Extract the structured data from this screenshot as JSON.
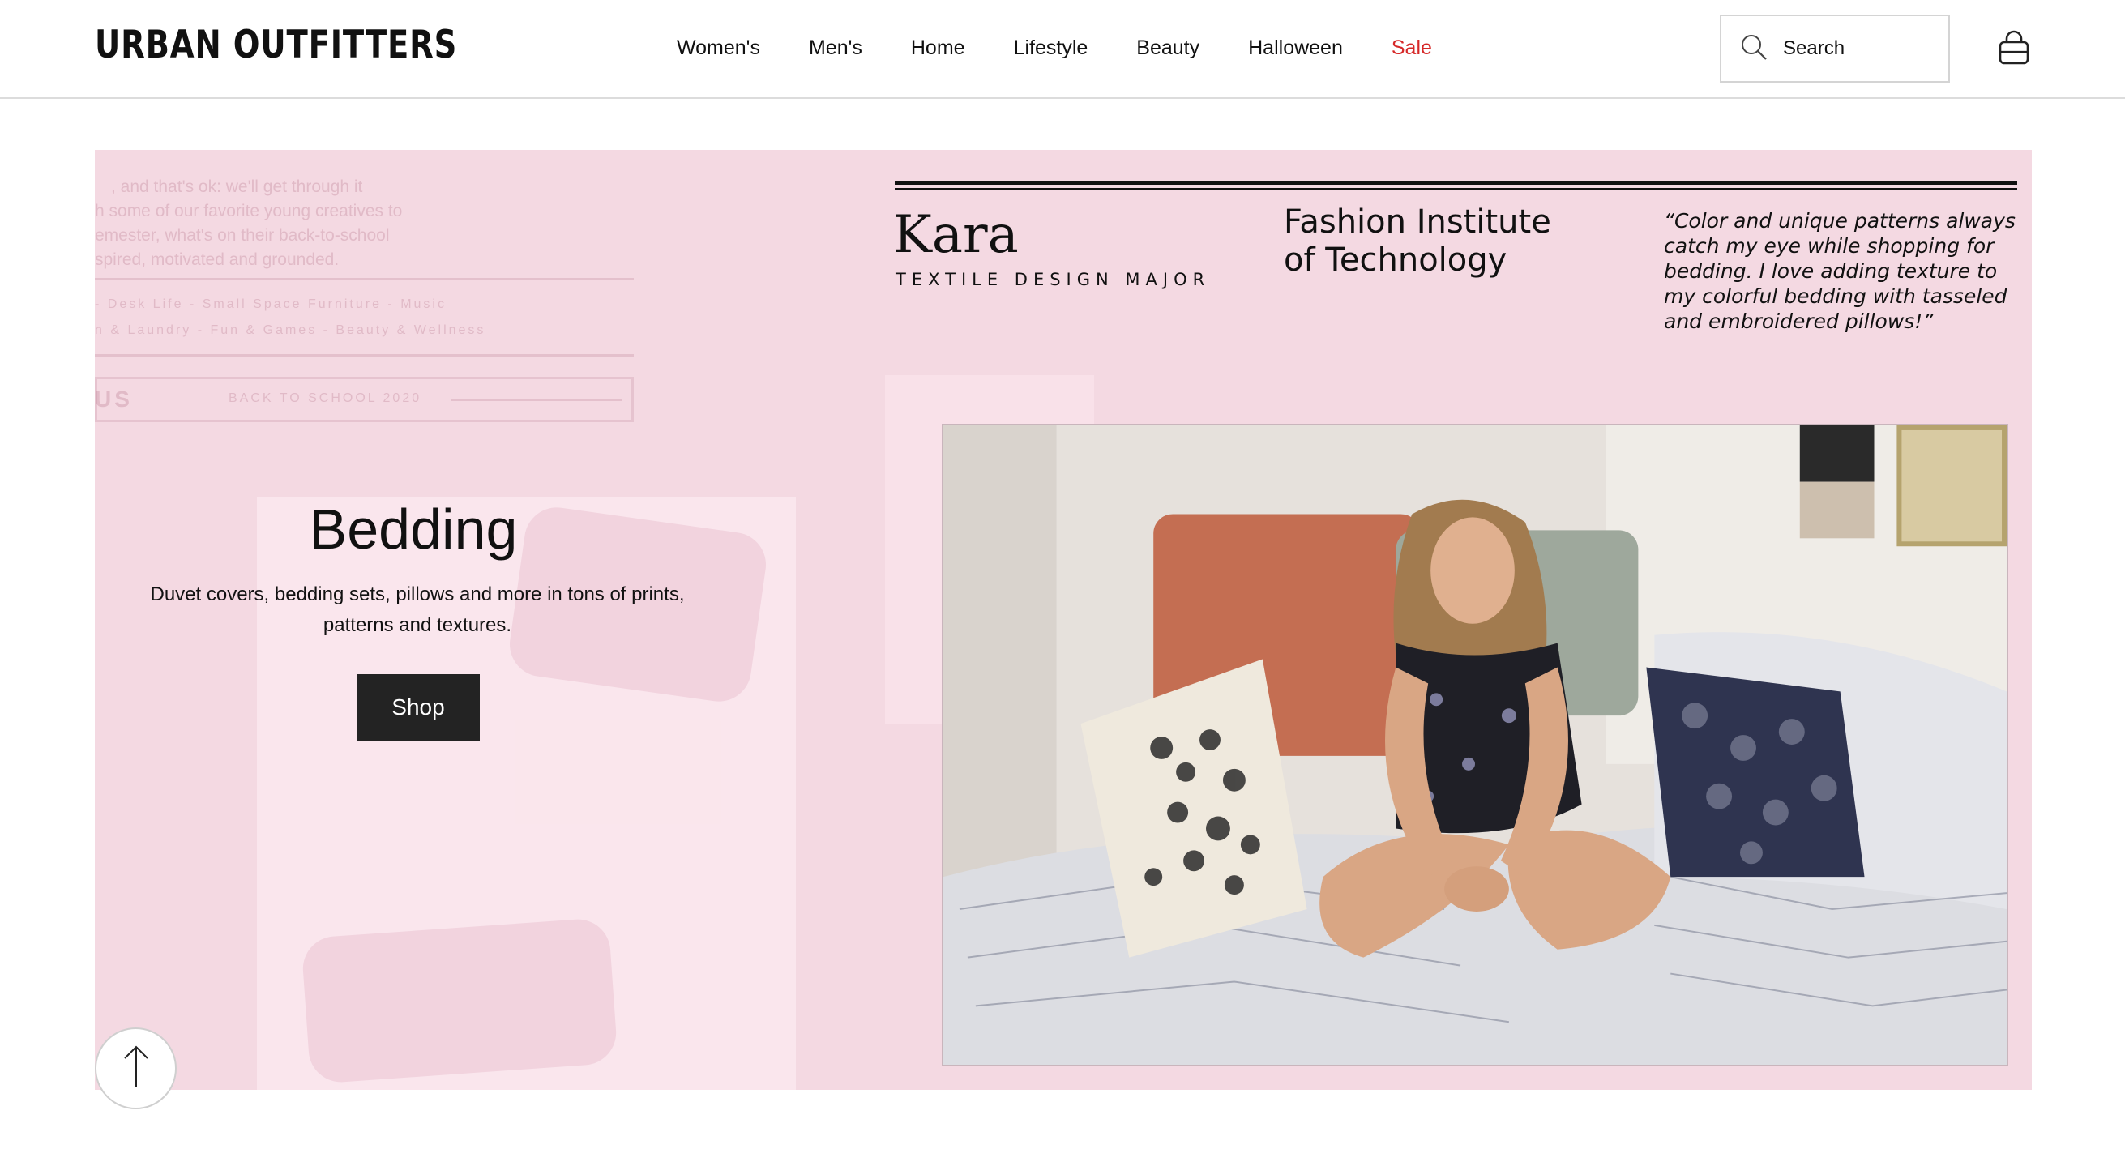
{
  "header": {
    "logo": "URBAN OUTFITTERS",
    "nav": [
      {
        "label": "Women's"
      },
      {
        "label": "Men's"
      },
      {
        "label": "Home"
      },
      {
        "label": "Lifestyle"
      },
      {
        "label": "Beauty"
      },
      {
        "label": "Halloween"
      },
      {
        "label": "Sale"
      }
    ],
    "search": {
      "placeholder": "Search",
      "value": ""
    },
    "cart_icon": "shopping-bag-icon"
  },
  "hero": {
    "title": "Bedding",
    "description": "Duvet covers, bedding sets, pillows and more in tons of prints, patterns and textures.",
    "shop_label": "Shop",
    "profile": {
      "name": "Kara",
      "major": "TEXTILE DESIGN MAJOR",
      "school": "Fashion Institute of Technology",
      "quote": "“Color and unique patterns always catch my eye while shopping for bedding. I love adding texture to my colorful bedding with tasseled and embroidered pillows!”"
    },
    "faded_text": {
      "line1": ", and that's ok: we'll get through it",
      "line2": "h some of our favorite young creatives to",
      "line3": "emester, what's on their back-to-school",
      "line4": "spired, motivated and grounded.",
      "line5": "- Desk   Life   -   Small  Space  Furniture   -   Music",
      "line6": "n & Laundry  -  Fun & Games  -  Beauty & Wellness",
      "badge": "US",
      "badge_caption": "BACK TO SCHOOL 2020"
    },
    "background_color": "#f4d9e2"
  },
  "back_to_top_icon": "arrow-up-icon",
  "colors": {
    "sale": "#d62828",
    "button": "#232323"
  }
}
